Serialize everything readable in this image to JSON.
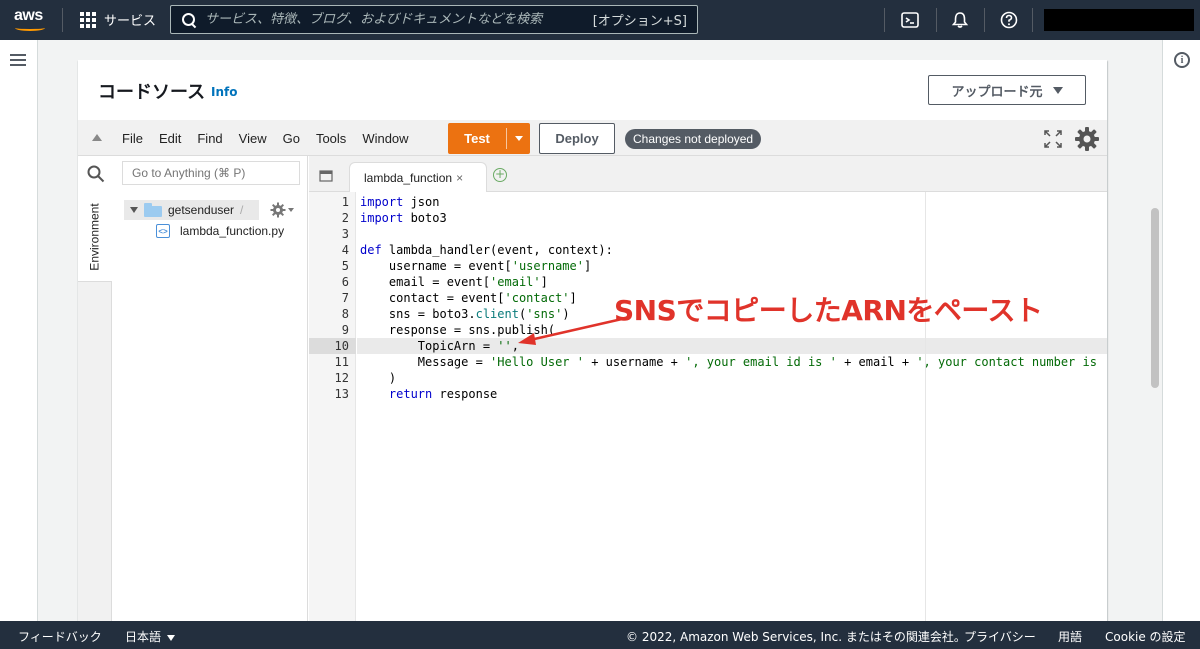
{
  "topnav": {
    "logo": "aws",
    "services_label": "サービス",
    "search_placeholder": "サービス、特徴、ブログ、およびドキュメントなどを検索",
    "search_shortcut": "[オプション+S]",
    "icons": [
      "cloudshell-icon",
      "bell-icon",
      "help-icon"
    ]
  },
  "panel": {
    "title": "コードソース",
    "info_link": "Info",
    "upload_button": "アップロード元"
  },
  "ide": {
    "menu": [
      "File",
      "Edit",
      "Find",
      "View",
      "Go",
      "Tools",
      "Window"
    ],
    "test_button": "Test",
    "deploy_button": "Deploy",
    "status": "Changes not deployed"
  },
  "tree": {
    "environment_tab": "Environment",
    "goto_placeholder": "Go to Anything (⌘ P)",
    "root_folder": "getsenduser",
    "root_suffix": "/",
    "file": "lambda_function.py"
  },
  "editor": {
    "tab_name": "lambda_function",
    "highlighted_line": 10,
    "line_numbers": [
      "1",
      "2",
      "3",
      "4",
      "5",
      "6",
      "7",
      "8",
      "9",
      "10",
      "11",
      "12",
      "13"
    ]
  },
  "code_tokens": {
    "import": "import",
    "json": " json",
    "boto3": " boto3",
    "def": "def",
    "handler": " lambda_handler(event, context):",
    "l5a": "    username = event[",
    "l5s": "'username'",
    "l5b": "]",
    "l6a": "    email = event[",
    "l6s": "'email'",
    "l6b": "]",
    "l7a": "    contact = event[",
    "l7s": "'contact'",
    "l7b": "]",
    "l8a": "    sns = boto3.",
    "l8f": "client",
    "l8b": "(",
    "l8s": "'sns'",
    "l8c": ")",
    "l9": "    response = sns.publish(",
    "l10a": "        TopicArn = ",
    "l10s": "''",
    "l10b": ",",
    "l11a": "        Message = ",
    "l11s1": "'Hello User '",
    "l11b": " + username + ",
    "l11s2": "', your email id is '",
    "l11c": " + email + ",
    "l11s3": "', your contact number is '",
    "l11d": " + ",
    "l12": "    )",
    "return": "    return",
    "l13": " response"
  },
  "annotation": {
    "text": "SNSでコピーしたARNをペースト",
    "color": "#e0332a"
  },
  "footer": {
    "feedback": "フィードバック",
    "language": "日本語",
    "copyright": "© 2022, Amazon Web Services, Inc. またはその関連会社。",
    "privacy": "プライバシー",
    "terms": "用語",
    "cookie": "Cookie の設定"
  },
  "colors": {
    "nav_bg": "#232f3e",
    "primary_orange": "#ec7211",
    "link_blue": "#0073bb",
    "keyword_blue": "#0000cc",
    "string_green": "#036a07"
  }
}
